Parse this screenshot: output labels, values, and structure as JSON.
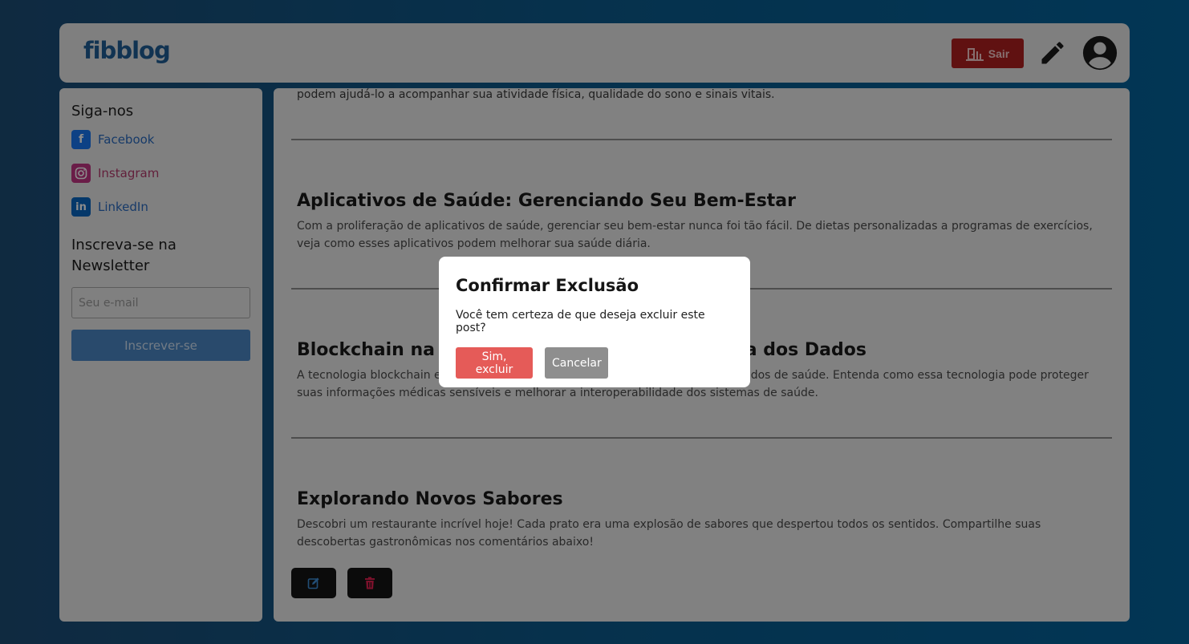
{
  "header": {
    "logo": "fibblog",
    "logout_label": "Sair",
    "logout_color": "#b01f1f"
  },
  "sidebar": {
    "follow_title": "Siga-nos",
    "socials": [
      {
        "label": "Facebook",
        "icon": "facebook-icon",
        "color": "#1877f2"
      },
      {
        "label": "Instagram",
        "icon": "instagram-icon",
        "color": "#c13584"
      },
      {
        "label": "LinkedIn",
        "icon": "linkedin-icon",
        "color": "#0a66c2"
      }
    ],
    "newsletter_title": "Inscreva-se na Newsletter",
    "email_placeholder": "Seu e-mail",
    "subscribe_label": "Inscrever-se"
  },
  "main": {
    "cut_text": "podem ajudá-lo a acompanhar sua atividade física, qualidade do sono e sinais vitais.",
    "posts": [
      {
        "title": "Aplicativos de Saúde: Gerenciando Seu Bem-Estar",
        "body": "Com a proliferação de aplicativos de saúde, gerenciar seu bem-estar nunca foi tão fácil. De dietas personalizadas a programas de exercícios, veja como esses aplicativos podem melhorar sua saúde diária."
      },
      {
        "title": "Blockchain na Saúde: Garantindo a Segurança dos Dados",
        "body": "A tecnologia blockchain está revolucionando a segurança e a integridade dos dados de saúde. Entenda como essa tecnologia pode proteger suas informações médicas sensíveis e melhorar a interoperabilidade dos sistemas de saúde."
      },
      {
        "title": "Explorando Novos Sabores",
        "body": "Descobri um restaurante incrível hoje! Cada prato era uma explosão de sabores que despertou todos os sentidos. Compartilhe suas descobertas gastronômicas nos comentários abaixo!"
      }
    ]
  },
  "modal": {
    "title": "Confirmar Exclusão",
    "text": "Você tem certeza de que deseja excluir este post?",
    "confirm_label": "Sim, excluir",
    "cancel_label": "Cancelar",
    "confirm_color": "#e55b58"
  }
}
